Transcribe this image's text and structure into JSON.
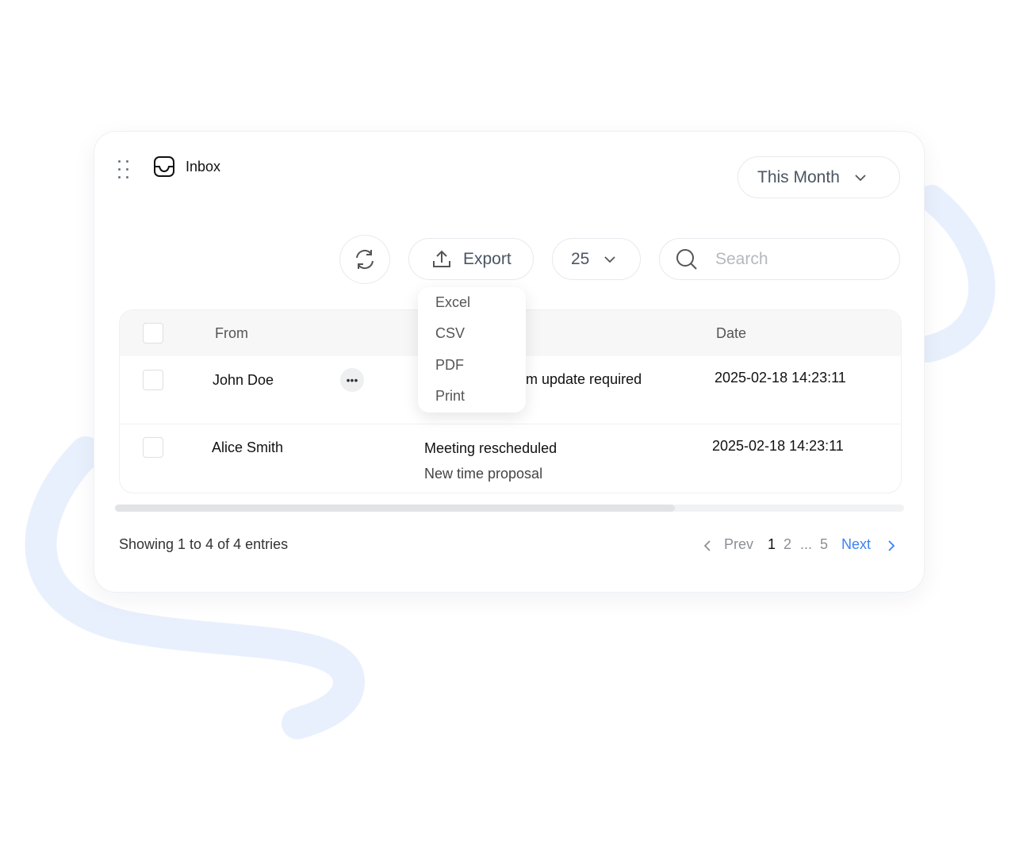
{
  "colors": {
    "accent": "#3b82f6",
    "decor": "#e9f0fd",
    "border": "#eef0f3"
  },
  "header": {
    "title": "Inbox",
    "period_label": "This Month"
  },
  "toolbar": {
    "export_label": "Export",
    "per_page": "25",
    "search_placeholder": "Search",
    "export_menu": [
      "Excel",
      "CSV",
      "PDF",
      "Print"
    ]
  },
  "table": {
    "headers": {
      "from": "From",
      "date": "Date"
    },
    "rows": [
      {
        "from": "John Doe",
        "subject": "m update required",
        "preview": "",
        "date": "2025-02-18 14:23:11"
      },
      {
        "from": "Alice Smith",
        "subject": "Meeting rescheduled",
        "preview": "New time proposal",
        "date": "2025-02-18 14:23:11"
      }
    ],
    "scroll_fraction": 0.71
  },
  "footer": {
    "showing": "Showing 1 to 4 of 4 entries",
    "prev": "Prev",
    "pages": [
      "1",
      "2",
      "...",
      "5"
    ],
    "current_page": "1",
    "next": "Next"
  }
}
